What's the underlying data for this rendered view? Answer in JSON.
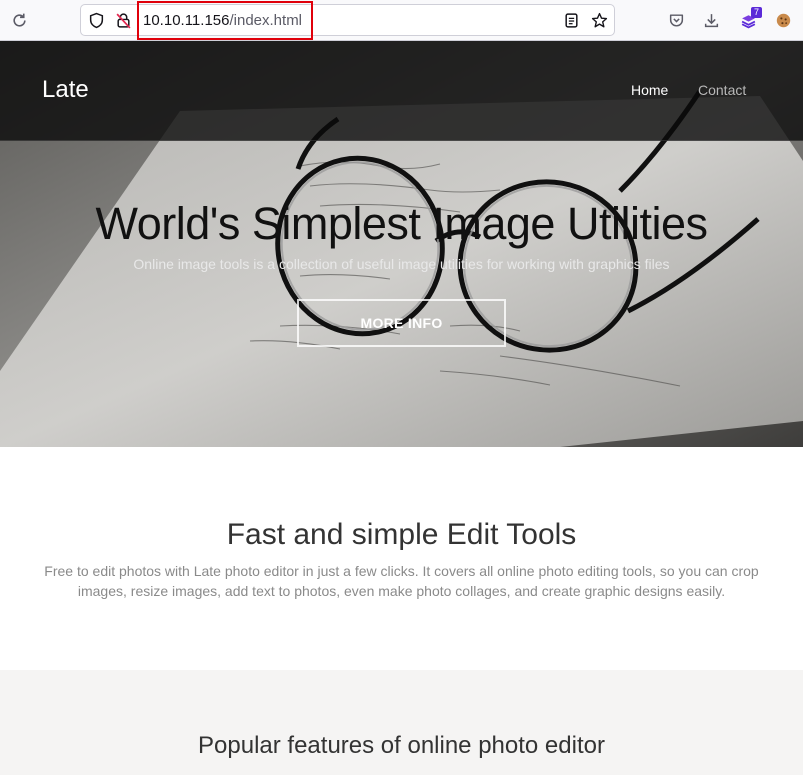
{
  "browser": {
    "url_host": "10.10.11.156",
    "url_path": "/index.html",
    "extension_badge": "7",
    "colors": {
      "highlight": "#e0000b",
      "badge": "#5b2ad8"
    },
    "icons": [
      "reload-icon",
      "shield-icon",
      "insecure-lock-icon",
      "reader-view-icon",
      "bookmark-star-icon",
      "pocket-icon",
      "download-icon",
      "extension-icon",
      "cookie-icon"
    ]
  },
  "site": {
    "brand": "Late",
    "nav": {
      "home": "Home",
      "contact": "Contact"
    },
    "hero": {
      "title": "World's Simplest Image Utilities",
      "subtitle": "Online image tools is a collection of useful image utilities for working with graphics files",
      "button": "MORE INFO"
    },
    "section1": {
      "title": "Fast and simple Edit Tools",
      "text": "Free to edit photos with Late photo editor in just a few clicks. It covers all online photo editing tools, so you can crop images, resize images, add text to photos, even make photo collages, and create graphic designs easily."
    },
    "section2": {
      "title": "Popular features of online photo editor"
    }
  }
}
